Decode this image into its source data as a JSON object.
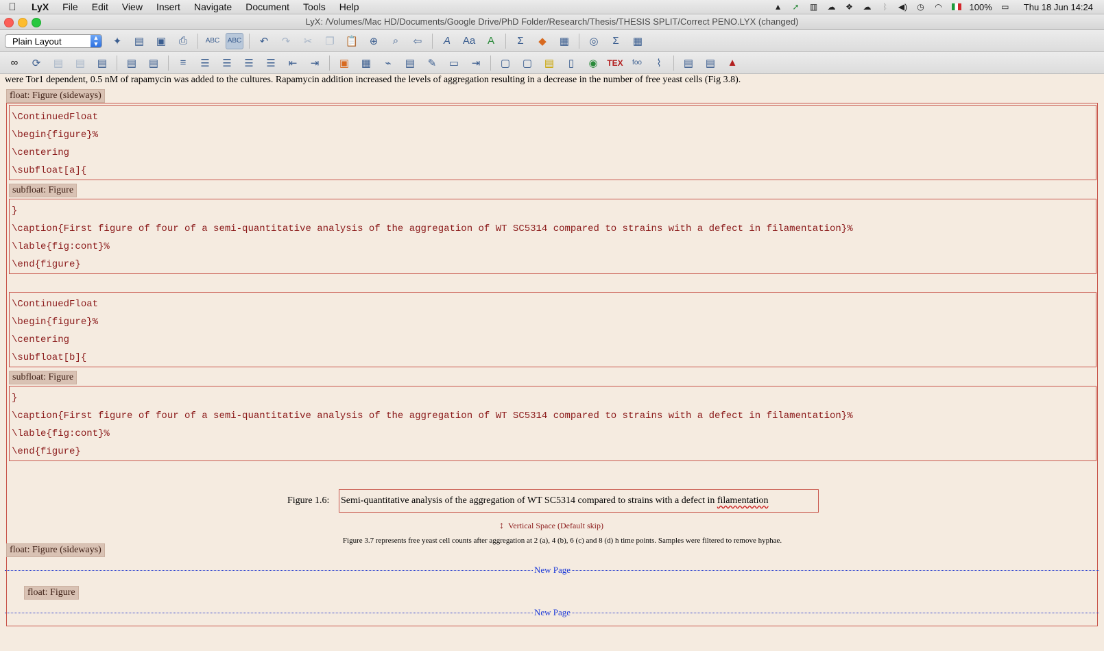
{
  "menubar": {
    "app": "LyX",
    "items": [
      "File",
      "Edit",
      "View",
      "Insert",
      "Navigate",
      "Document",
      "Tools",
      "Help"
    ],
    "status_icons": [
      "drive-icon",
      "green-arrow-icon",
      "bank-icon",
      "cloud-icon",
      "dropbox-icon",
      "cloud-dark-icon",
      "bluetooth-icon",
      "volume-icon",
      "time-machine-icon",
      "wifi-icon",
      "flag-icon"
    ],
    "battery": "100%",
    "datetime": "Thu 18 Jun  14:24"
  },
  "window": {
    "title": "LyX: /Volumes/Mac HD/Documents/Google Drive/PhD Folder/Research/Thesis/THESIS SPLIT/Correct PENO.LYX (changed)"
  },
  "toolbar": {
    "layout_value": "Plain Layout"
  },
  "document": {
    "intro": "were Tor1 dependent, 0.5 nM of rapamycin was added to the cultures. Rapamycin addition increased the levels of aggregation resulting in a decrease in the number of free yeast cells (Fig 3.8).",
    "float_label": "float: Figure (sideways)",
    "subfloat_label": "subfloat: Figure",
    "block1_lines": [
      "\\ContinuedFloat",
      "\\begin{figure}%",
      "\\centering",
      "\\subfloat[a]{"
    ],
    "block2_lines": [
      "}",
      "\\caption{First figure of four of a semi-quantitative analysis of the aggregation of WT SC5314 compared to strains with a defect in filamentation}%",
      "\\lable{fig:cont}%",
      "\\end{figure}"
    ],
    "block3_lines": [
      "\\ContinuedFloat",
      "\\begin{figure}%",
      "\\centering",
      "\\subfloat[b]{"
    ],
    "block4_lines": [
      "}",
      "\\caption{First figure of four of a semi-quantitative analysis of the aggregation of WT SC5314 compared to strains with a defect in filamentation}%",
      "\\lable{fig:cont}%",
      "\\end{figure}"
    ],
    "caption_label": "Figure 1.6:",
    "caption_text": "Semi-quantitative analysis of the aggregation of WT SC5314 compared to strains with a defect in ",
    "caption_err_word": "filamentation",
    "vspace": "Vertical Space (Default skip)",
    "small_caption": "Figure 3.7 represents free yeast cell counts after aggregation at 2 (a), 4 (b), 6 (c) and 8 (d) h time points. Samples were filtered to remove hyphae.",
    "float_label2": "float: Figure (sideways)",
    "newpage": "New Page",
    "float_label3": "float: Figure",
    "newpage2": "New Page"
  }
}
